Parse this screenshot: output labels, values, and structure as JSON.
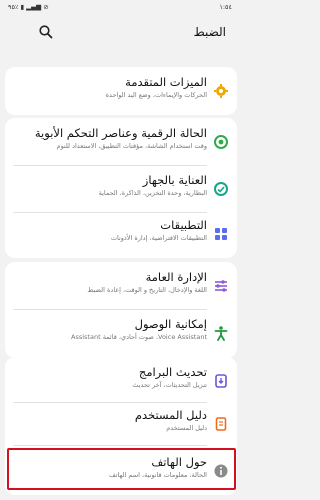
{
  "statusbar": {
    "time": "١:٥٤",
    "indicators": "٩٥٪ ▮ ▂▄▆ ⊘"
  },
  "header": {
    "title": "الضبط",
    "search_icon": "search-icon"
  },
  "colors": {
    "advanced": "#f0a800",
    "digital": "#2faa4a",
    "device_care": "#17a58a",
    "apps": "#5a6cf0",
    "general": "#8a5cd9",
    "accessibility": "#1f9b3a",
    "update": "#6b57d6",
    "manual": "#f26b1d",
    "about": "#8a8a8a",
    "highlight": "#d40f1f"
  },
  "sections": [
    {
      "items": [
        {
          "title": "الميزات المتقدمة",
          "subtitle": "الحركات والإيماءات، وضع اليد الواحدة",
          "icon": "gear-plus-icon"
        }
      ]
    },
    {
      "items": [
        {
          "title": "الحالة الرقمية وعناصر التحكم الأبوية",
          "subtitle": "وقت استخدام الشاشة، مؤقتات التطبيق، الاستعداد للنوم",
          "icon": "digital-wellbeing-icon"
        },
        {
          "title": "العناية بالجهاز",
          "subtitle": "البطارية، وحدة التخزين، الذاكرة، الحماية",
          "icon": "device-care-icon"
        },
        {
          "title": "التطبيقات",
          "subtitle": "التطبيقات الافتراضية، إدارة الأذونات",
          "icon": "apps-grid-icon"
        }
      ]
    },
    {
      "items": [
        {
          "title": "الإدارة العامة",
          "subtitle": "اللغة والإدخال، التاريخ و الوقت، إعادة الضبط",
          "icon": "sliders-icon"
        },
        {
          "title": "إمكانية الوصول",
          "subtitle": "Voice Assistant، صوت أحادي، قائمة Assistant",
          "icon": "accessibility-icon"
        }
      ]
    },
    {
      "items": [
        {
          "title": "تحديث البرامج",
          "subtitle": "تنزيل التحديثات، آخر تحديث",
          "icon": "software-update-icon"
        },
        {
          "title": "دليل المستخدم",
          "subtitle": "دليل المستخدم",
          "icon": "user-manual-icon"
        },
        {
          "title": "حول الهاتف",
          "subtitle": "الحالة، معلومات قانونية، اسم الهاتف",
          "icon": "info-icon"
        }
      ]
    }
  ]
}
